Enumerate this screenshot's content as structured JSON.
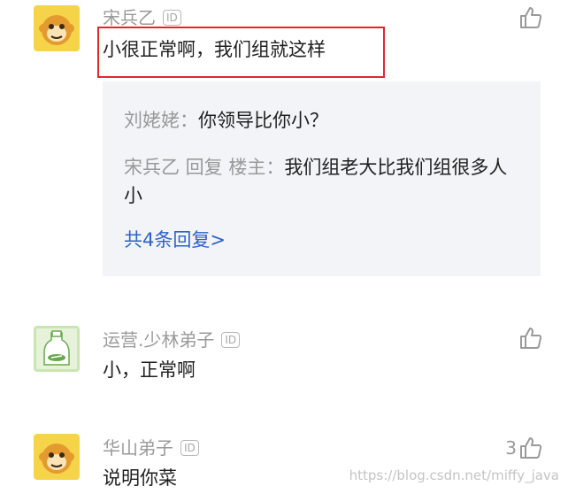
{
  "comments": [
    {
      "username": "宋兵乙",
      "id_badge": "ID",
      "text": "小很正常啊，我们组就这样",
      "avatar_icon": "monkey-avatar-icon",
      "likes": "",
      "replies": [
        {
          "name": "刘姥姥：",
          "text": "你领导比你小？"
        },
        {
          "name": "宋兵乙 回复 楼主：",
          "text": "我们组老大比我们组很多人小"
        }
      ],
      "more_replies": "共4条回复>"
    },
    {
      "username": "运营.少林弟子",
      "id_badge": "ID",
      "text": "小，正常啊",
      "avatar_icon": "bottle-avatar-icon",
      "likes": ""
    },
    {
      "username": "华山弟子",
      "id_badge": "ID",
      "text": "说明你菜",
      "avatar_icon": "monkey-avatar-icon",
      "likes": "3"
    }
  ],
  "watermark": "https://blog.csdn.net/miffy_java",
  "colors": {
    "highlight_border": "#e1272c",
    "link_blue": "#2c63c9",
    "reply_bg": "#f3f4f7",
    "muted": "#9a9a9a"
  }
}
